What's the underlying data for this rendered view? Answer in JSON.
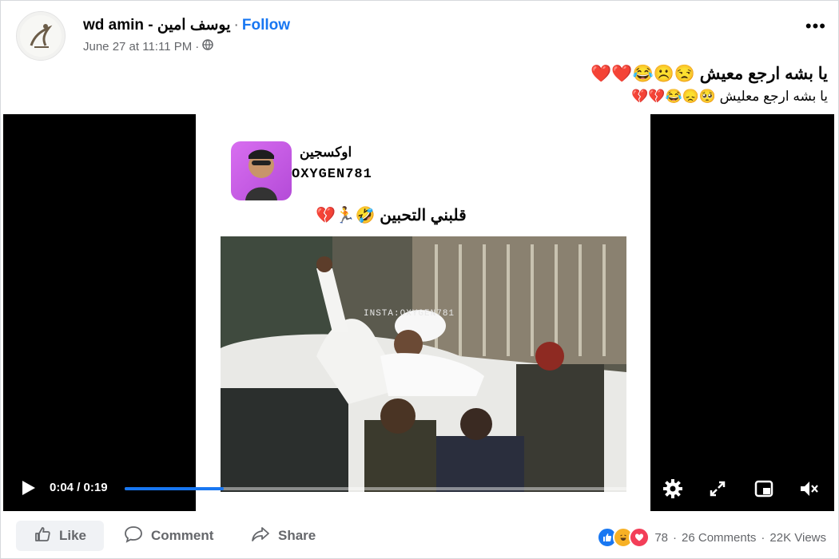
{
  "post": {
    "author": "wd amin - يوسف امين",
    "separator": "·",
    "follow_label": "Follow",
    "timestamp": "June 27 at 11:11 PM",
    "meta_separator": "·",
    "privacy_icon": "globe-icon",
    "more_label": "•••",
    "caption_primary": "يا بشه ارجع معيش 😒☹️😂❤️❤️",
    "caption_secondary": "يا بشه ارجع معليش 🥺😞😂💔💔"
  },
  "video": {
    "channel_name_ar": "اوكسجين",
    "channel_name_en": "OXYGEN781",
    "overlay_title": "قلبني التحبين 🤣🏃💔",
    "watermark": "INSTA:OXYGEN781",
    "current_time": "0:04",
    "time_separator": "/",
    "duration": "0:19",
    "progress_fraction": 0.19,
    "controls": [
      "play-icon",
      "settings-icon",
      "fullscreen-icon",
      "picture-in-picture-icon",
      "volume-icon"
    ]
  },
  "footer": {
    "like_label": "Like",
    "comment_label": "Comment",
    "share_label": "Share",
    "reaction_count": "78",
    "comments_label": "26 Comments",
    "views_label": "22K Views",
    "stat_separator": "·"
  },
  "colors": {
    "accent": "#1877f2",
    "secondary_text": "#65676b",
    "video_bg": "#000000",
    "love": "#f33e58",
    "haha": "#f7b125"
  }
}
